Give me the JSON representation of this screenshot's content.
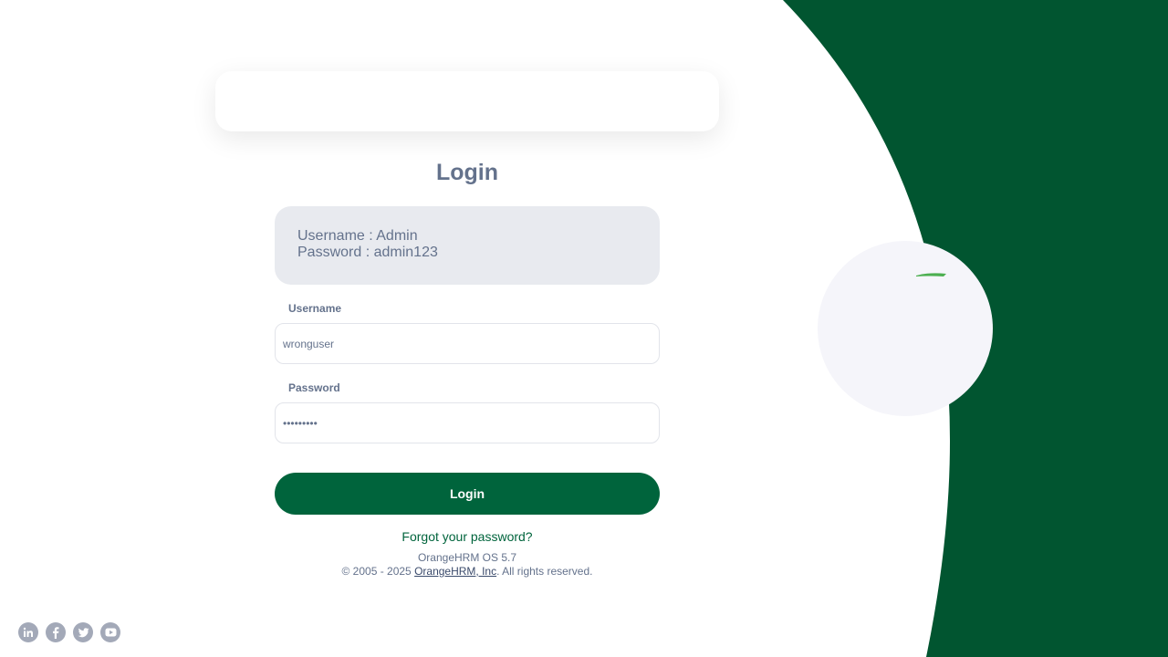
{
  "login": {
    "title": "Login",
    "credentials_hint": {
      "username_line": "Username : Admin",
      "password_line": "Password : admin123"
    },
    "username": {
      "label": "Username",
      "value": "wronguser"
    },
    "password": {
      "label": "Password",
      "value": "wrongpass"
    },
    "submit_label": "Login",
    "forgot_password": "Forgot your password?"
  },
  "footer": {
    "version": "OrangeHRM OS 5.7",
    "copyright_prefix": "© 2005 - 2025 ",
    "company_link": "OrangeHRM, Inc",
    "copyright_suffix": ". All rights reserved."
  },
  "social": [
    {
      "icon": "linkedin-icon"
    },
    {
      "icon": "facebook-icon"
    },
    {
      "icon": "twitter-icon"
    },
    {
      "icon": "youtube-icon"
    }
  ],
  "colors": {
    "brand_green": "#00643c",
    "background_green": "#015530",
    "text_muted": "#64728c",
    "hint_bg": "#e8eaef"
  }
}
